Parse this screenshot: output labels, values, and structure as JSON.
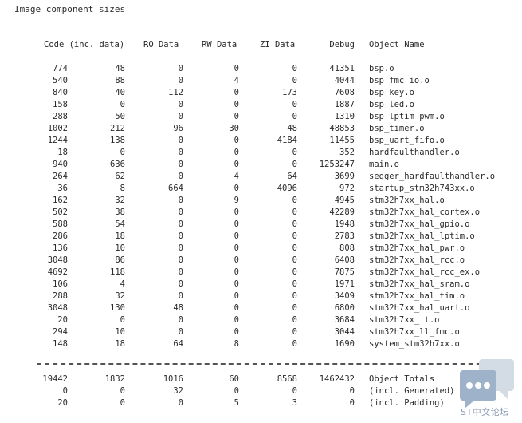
{
  "title": "Image component sizes",
  "header": {
    "code": "Code (inc. data)",
    "ro": "RO Data",
    "rw": "RW Data",
    "zi": "ZI Data",
    "debug": "Debug",
    "name": "Object Name"
  },
  "rows": [
    {
      "code": "774",
      "data": "48",
      "ro": "0",
      "rw": "0",
      "zi": "0",
      "debug": "41351",
      "name": "bsp.o"
    },
    {
      "code": "540",
      "data": "88",
      "ro": "0",
      "rw": "4",
      "zi": "0",
      "debug": "4044",
      "name": "bsp_fmc_io.o"
    },
    {
      "code": "840",
      "data": "40",
      "ro": "112",
      "rw": "0",
      "zi": "173",
      "debug": "7608",
      "name": "bsp_key.o"
    },
    {
      "code": "158",
      "data": "0",
      "ro": "0",
      "rw": "0",
      "zi": "0",
      "debug": "1887",
      "name": "bsp_led.o"
    },
    {
      "code": "288",
      "data": "50",
      "ro": "0",
      "rw": "0",
      "zi": "0",
      "debug": "1310",
      "name": "bsp_lptim_pwm.o"
    },
    {
      "code": "1002",
      "data": "212",
      "ro": "96",
      "rw": "30",
      "zi": "48",
      "debug": "48853",
      "name": "bsp_timer.o"
    },
    {
      "code": "1244",
      "data": "138",
      "ro": "0",
      "rw": "0",
      "zi": "4184",
      "debug": "11455",
      "name": "bsp_uart_fifo.o"
    },
    {
      "code": "18",
      "data": "0",
      "ro": "0",
      "rw": "0",
      "zi": "0",
      "debug": "352",
      "name": "hardfaulthandler.o"
    },
    {
      "code": "940",
      "data": "636",
      "ro": "0",
      "rw": "0",
      "zi": "0",
      "debug": "1253247",
      "name": "main.o"
    },
    {
      "code": "264",
      "data": "62",
      "ro": "0",
      "rw": "4",
      "zi": "64",
      "debug": "3699",
      "name": "segger_hardfaulthandler.o"
    },
    {
      "code": "36",
      "data": "8",
      "ro": "664",
      "rw": "0",
      "zi": "4096",
      "debug": "972",
      "name": "startup_stm32h743xx.o"
    },
    {
      "code": "162",
      "data": "32",
      "ro": "0",
      "rw": "9",
      "zi": "0",
      "debug": "4945",
      "name": "stm32h7xx_hal.o"
    },
    {
      "code": "502",
      "data": "38",
      "ro": "0",
      "rw": "0",
      "zi": "0",
      "debug": "42289",
      "name": "stm32h7xx_hal_cortex.o"
    },
    {
      "code": "588",
      "data": "54",
      "ro": "0",
      "rw": "0",
      "zi": "0",
      "debug": "1948",
      "name": "stm32h7xx_hal_gpio.o"
    },
    {
      "code": "286",
      "data": "18",
      "ro": "0",
      "rw": "0",
      "zi": "0",
      "debug": "2783",
      "name": "stm32h7xx_hal_lptim.o"
    },
    {
      "code": "136",
      "data": "10",
      "ro": "0",
      "rw": "0",
      "zi": "0",
      "debug": "808",
      "name": "stm32h7xx_hal_pwr.o"
    },
    {
      "code": "3048",
      "data": "86",
      "ro": "0",
      "rw": "0",
      "zi": "0",
      "debug": "6408",
      "name": "stm32h7xx_hal_rcc.o"
    },
    {
      "code": "4692",
      "data": "118",
      "ro": "0",
      "rw": "0",
      "zi": "0",
      "debug": "7875",
      "name": "stm32h7xx_hal_rcc_ex.o"
    },
    {
      "code": "106",
      "data": "4",
      "ro": "0",
      "rw": "0",
      "zi": "0",
      "debug": "1971",
      "name": "stm32h7xx_hal_sram.o"
    },
    {
      "code": "288",
      "data": "32",
      "ro": "0",
      "rw": "0",
      "zi": "0",
      "debug": "3409",
      "name": "stm32h7xx_hal_tim.o"
    },
    {
      "code": "3048",
      "data": "130",
      "ro": "48",
      "rw": "0",
      "zi": "0",
      "debug": "6800",
      "name": "stm32h7xx_hal_uart.o"
    },
    {
      "code": "20",
      "data": "0",
      "ro": "0",
      "rw": "0",
      "zi": "0",
      "debug": "3684",
      "name": "stm32h7xx_it.o"
    },
    {
      "code": "294",
      "data": "10",
      "ro": "0",
      "rw": "0",
      "zi": "0",
      "debug": "3044",
      "name": "stm32h7xx_ll_fmc.o"
    },
    {
      "code": "148",
      "data": "18",
      "ro": "64",
      "rw": "8",
      "zi": "0",
      "debug": "1690",
      "name": "system_stm32h7xx.o"
    }
  ],
  "totals": [
    {
      "code": "19442",
      "data": "1832",
      "ro": "1016",
      "rw": "60",
      "zi": "8568",
      "debug": "1462432",
      "name": "Object Totals"
    },
    {
      "code": "0",
      "data": "0",
      "ro": "32",
      "rw": "0",
      "zi": "0",
      "debug": "0",
      "name": "(incl. Generated)"
    },
    {
      "code": "20",
      "data": "0",
      "ro": "0",
      "rw": "5",
      "zi": "3",
      "debug": "0",
      "name": "(incl. Padding)"
    }
  ],
  "watermark": {
    "icon": "chat-bubble-icon",
    "text": "ST中文论坛",
    "colors": {
      "front": "#9eb3c9",
      "back": "#d3dbe4",
      "dots": "#ffffff"
    }
  }
}
